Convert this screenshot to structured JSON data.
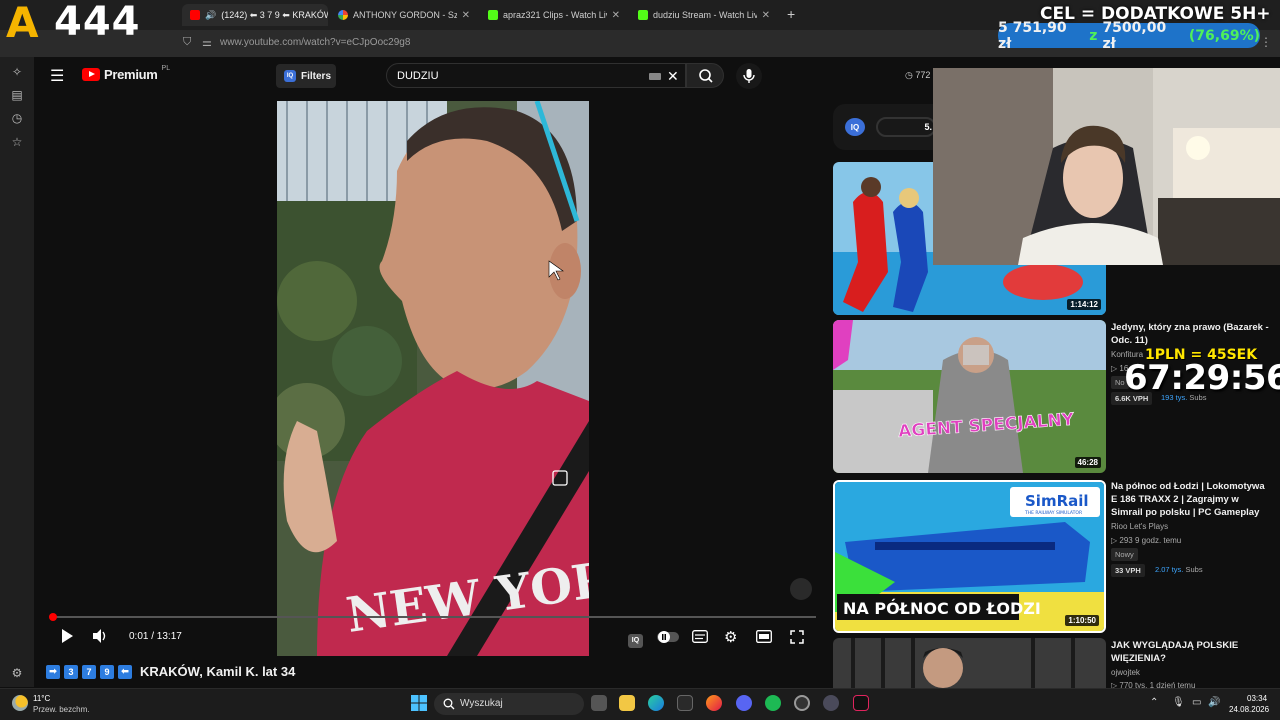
{
  "browser": {
    "tabs": [
      {
        "label": "(1242) ⬅ 3 7 9 ⬅ KRAKÓW",
        "close": "✕"
      },
      {
        "label": "ANTHONY GORDON - Szukaj w Google",
        "close": "✕"
      },
      {
        "label": "apraz321 Clips - Watch Live on Kick",
        "close": "✕"
      },
      {
        "label": "dudziu Stream - Watch Live on Kick",
        "close": "✕"
      }
    ],
    "new_tab": "+",
    "url": "www.youtube.com/watch?v=eCJpOoc29g8"
  },
  "overlay": {
    "logo_mark": "A",
    "logo_number": "444",
    "goal_title": "CEL = DODATKOWE 5H+",
    "goal_current": "5 751,90 zł",
    "goal_sep": "z",
    "goal_target": "7500,00 zł",
    "goal_pct": "(76,69%)",
    "timer_rate": "1PLN = 45SEK",
    "timer": "67:29:56"
  },
  "youtube": {
    "logo_text": "Premium",
    "logo_region": "PL",
    "filters_icon": "IQ",
    "filters_label": "Filters",
    "search_value": "DUDZIU",
    "header_views": "772",
    "sidebar_pill_text": "5.",
    "sidebar_icon": "IQ"
  },
  "player": {
    "time": "0:01 / 13:17",
    "title_prefix": [
      "➡",
      "3",
      "7",
      "9",
      "⬅"
    ],
    "title": "KRAKÓW, Kamil K. lat 34"
  },
  "recommendations": [
    {
      "duration": "1:14:12"
    },
    {
      "duration": "46:28",
      "title": "Jedyny, który zna prawo (Bazarek - Odc. 11)",
      "channel": "Konfitura",
      "meta": "▷ 16",
      "badge": "No",
      "vph": "6.6K VPH",
      "subs_value": "193",
      "subs_unit": "tys.",
      "subs_label": "Subs",
      "thumb_text": "AGENT SPECJALNY"
    },
    {
      "duration": "1:10:50",
      "title": "Na północ od Łodzi | Lokomotywa E 186 TRAXX 2 | Zagrajmy w Simrail po polsku | PC Gameplay",
      "channel": "Rioo Let's Plays",
      "meta": "▷ 293  9 godz. temu",
      "badge": "Nowy",
      "vph": "33 VPH",
      "subs_value": "2.07",
      "subs_unit": "tys.",
      "subs_label": "Subs",
      "thumb_text": "NA PÓŁNOC OD ŁODZI",
      "thumb_brand": "SimRail",
      "thumb_brand_sub": "THE RAILWAY SIMULATOR"
    },
    {
      "title": "JAK WYGLĄDAJĄ POLSKIE WIĘZIENIA?",
      "channel": "ojwojtek",
      "meta": "▷ 770 tys.  1 dzień temu"
    }
  ],
  "taskbar": {
    "temp": "11°C",
    "weather": "Przew. bezchm.",
    "search_label": "Wyszukaj",
    "time": "03:34",
    "date": "24.08.2026"
  },
  "colors": {
    "accent_red": "#ff0000",
    "goal_blue": "#1e73c9",
    "goal_green": "#4ff05a",
    "timer_yellow": "#ffe600"
  }
}
